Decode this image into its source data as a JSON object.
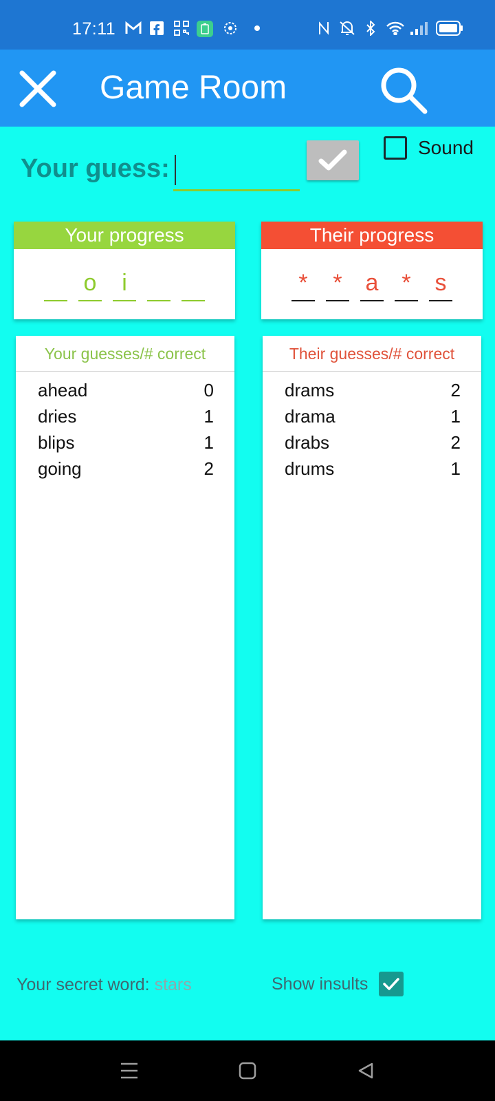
{
  "status_bar": {
    "time": "17:11",
    "icons": [
      "gmail-icon",
      "facebook-icon",
      "qr-icon",
      "battery-saver-icon",
      "app-icon",
      "dot-icon",
      "nfc-icon",
      "mute-icon",
      "bluetooth-icon",
      "wifi-icon",
      "signal-icon",
      "battery-icon"
    ]
  },
  "app_bar": {
    "title": "Game Room"
  },
  "guess": {
    "label": "Your guess:",
    "value": "",
    "placeholder": ""
  },
  "sound": {
    "label": "Sound",
    "checked": false
  },
  "your_progress": {
    "header": "Your progress",
    "header_color": "#97d63f",
    "letters": [
      "",
      "o",
      "i",
      "",
      ""
    ]
  },
  "their_progress": {
    "header": "Their progress",
    "header_color": "#f44f34",
    "letters": [
      "*",
      "*",
      "a",
      "*",
      "s"
    ]
  },
  "your_guesses": {
    "header": "Your guesses/# correct",
    "header_color": "#8bc34a",
    "rows": [
      {
        "word": "ahead",
        "correct": "0"
      },
      {
        "word": "dries",
        "correct": "1"
      },
      {
        "word": "blips",
        "correct": "1"
      },
      {
        "word": "going",
        "correct": "2"
      }
    ]
  },
  "their_guesses": {
    "header": "Their guesses/# correct",
    "header_color": "#e0533b",
    "rows": [
      {
        "word": "drams",
        "correct": "2"
      },
      {
        "word": "drama",
        "correct": "1"
      },
      {
        "word": "drabs",
        "correct": "2"
      },
      {
        "word": "drums",
        "correct": "1"
      }
    ]
  },
  "footer": {
    "secret_label": "Your secret word:",
    "secret_word": "stars",
    "insults_label": "Show insults",
    "insults_checked": true
  }
}
